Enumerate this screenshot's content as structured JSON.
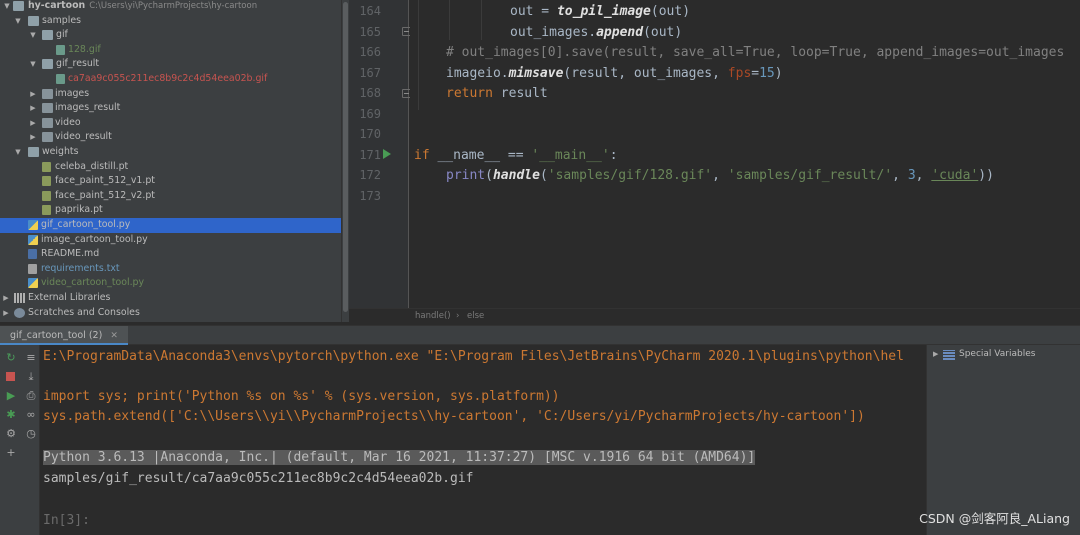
{
  "project_tree": {
    "root": {
      "name": "hy-cartoon",
      "path": "C:\\Users\\yi\\PycharmProjects\\hy-cartoon"
    },
    "items": [
      {
        "label": "samples"
      },
      {
        "label": "gif"
      },
      {
        "label": "128.gif"
      },
      {
        "label": "gif_result"
      },
      {
        "label": "ca7aa9c055c211ec8b9c2c4d54eea02b.gif"
      },
      {
        "label": "images"
      },
      {
        "label": "images_result"
      },
      {
        "label": "video"
      },
      {
        "label": "video_result"
      },
      {
        "label": "weights"
      },
      {
        "label": "celeba_distill.pt"
      },
      {
        "label": "face_paint_512_v1.pt"
      },
      {
        "label": "face_paint_512_v2.pt"
      },
      {
        "label": "paprika.pt"
      },
      {
        "label": "gif_cartoon_tool.py"
      },
      {
        "label": "image_cartoon_tool.py"
      },
      {
        "label": "README.md"
      },
      {
        "label": "requirements.txt"
      },
      {
        "label": "video_cartoon_tool.py"
      },
      {
        "label": "External Libraries"
      },
      {
        "label": "Scratches and Consoles"
      }
    ]
  },
  "editor": {
    "line_numbers": [
      "164",
      "165",
      "166",
      "167",
      "168",
      "169",
      "170",
      "171",
      "172",
      "173"
    ],
    "code": {
      "l164": {
        "lhs": "out = ",
        "fn": "to_pil_image",
        "rest": "(out)"
      },
      "l165": {
        "obj": "out_images.",
        "fn": "append",
        "rest": "(out)"
      },
      "l166": {
        "comment": "# out_images[0].save(result, save_all=True, loop=True, append_images=out_images"
      },
      "l167": {
        "obj": "imageio.",
        "fn": "mimsave",
        "args": "(result, out_images, ",
        "param": "fps",
        "eq": "=",
        "num": "15",
        "close": ")"
      },
      "l168": {
        "kw": "return",
        "rest": " result"
      },
      "l171": {
        "kw": "if",
        "sp": " ",
        "dunder": "__name__",
        "op": " == ",
        "str": "'__main__'",
        "colon": ":"
      },
      "l172": {
        "builtin": "print",
        "p1": "(",
        "fn": "handle",
        "p2": "(",
        "s1": "'samples/gif/128.gif'",
        "c1": ", ",
        "s2": "'samples/gif_result/'",
        "c2": ", ",
        "num": "3",
        "c3": ", ",
        "s3": "'cuda'",
        "close": "))"
      }
    },
    "breadcrumb": [
      "handle()",
      "else"
    ]
  },
  "console": {
    "tab_label": "gif_cartoon_tool (2)",
    "lines": {
      "cmd": "E:\\ProgramData\\Anaconda3\\envs\\pytorch\\python.exe \"E:\\Program Files\\JetBrains\\PyCharm 2020.1\\plugins\\python\\hel",
      "import": "import sys; print('Python %s on %s' % (sys.version, sys.platform))",
      "path": "sys.path.extend(['C:\\\\Users\\\\yi\\\\PycharmProjects\\\\hy-cartoon', 'C:/Users/yi/PycharmProjects/hy-cartoon'])",
      "version": "Python 3.6.13 |Anaconda, Inc.| (default, Mar 16 2021, 11:37:27) [MSC v.1916 64 bit (AMD64)]",
      "result": "samples/gif_result/ca7aa9c055c211ec8b9c2c4d54eea02b.gif",
      "prompt": "In[3]:"
    },
    "variables_panel": {
      "label": "Special Variables"
    }
  },
  "watermark": "CSDN @剑客阿良_ALiang",
  "colors": {
    "tree_bg": "#3c3f41",
    "editor_bg": "#2b2b2b",
    "selection": "#2f65ca",
    "keyword": "#cc7832",
    "string": "#6a8759",
    "number": "#6897bb",
    "comment": "#808080"
  }
}
